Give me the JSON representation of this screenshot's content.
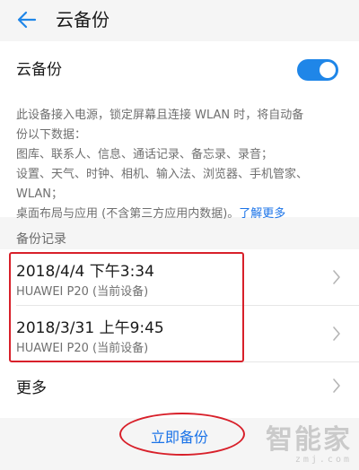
{
  "header": {
    "title": "云备份"
  },
  "settings": {
    "toggle_label": "云备份",
    "toggle_on": true,
    "description_lines": [
      "此设备接入电源，锁定屏幕且连接 WLAN 时，将自动备",
      "份以下数据：",
      "图库、联系人、信息、通话记录、备忘录、录音；",
      "设置、天气、时钟、相机、输入法、浏览器、手机管家、",
      "WLAN；"
    ],
    "last_line_text": "桌面布局与应用 (不含第三方应用内数据)。",
    "learn_more": "了解更多"
  },
  "records": {
    "section_label": "备份记录",
    "items": [
      {
        "datetime": "2018/4/4 下午3:34",
        "device": "HUAWEI P20 (当前设备)"
      },
      {
        "datetime": "2018/3/31 上午9:45",
        "device": "HUAWEI P20 (当前设备)"
      }
    ],
    "more_label": "更多"
  },
  "actions": {
    "backup_now": "立即备份"
  },
  "watermark": {
    "main": "智能家",
    "sub": "zmj.com"
  },
  "colors": {
    "accent": "#1f86e8",
    "link": "#1a73e8",
    "annotation": "#d8202a"
  }
}
